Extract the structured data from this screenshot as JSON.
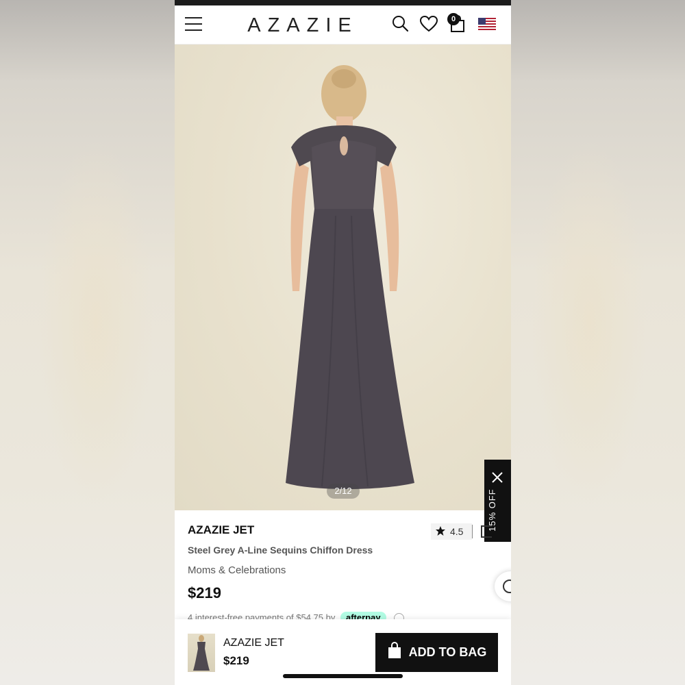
{
  "header": {
    "logo": "AZAZIE",
    "bag_count": "0"
  },
  "gallery": {
    "counter": "2/12"
  },
  "promo": {
    "label": "15% OFF"
  },
  "product": {
    "brand": "AZAZIE JET",
    "name": "Steel Grey A-Line Sequins Chiffon Dress",
    "category": "Moms & Celebrations",
    "price": "$219",
    "rating": "4.5",
    "installments_text": "4 interest-free payments of $54.75 by",
    "afterpay_label": "afterpay"
  },
  "bottom_bar": {
    "name": "AZAZIE JET",
    "price": "$219",
    "add_to_bag_label": "ADD TO BAG"
  },
  "colors": {
    "accent": "#111111",
    "dress": "#4f4950",
    "afterpay": "#b2fce4"
  }
}
